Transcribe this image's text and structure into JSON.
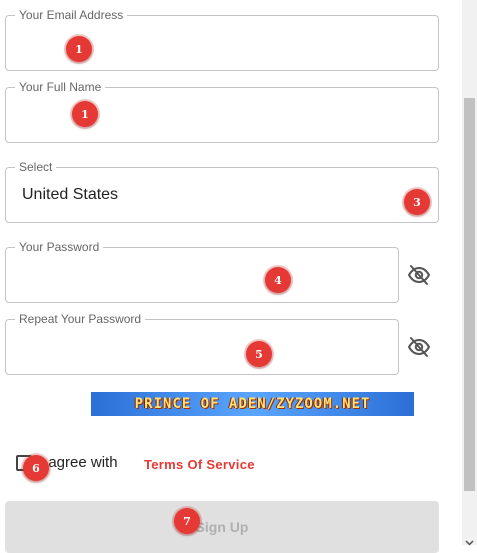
{
  "form": {
    "email": {
      "label": "Your Email Address",
      "value": ""
    },
    "full_name": {
      "label": "Your Full Name",
      "value": ""
    },
    "country": {
      "label": "Select",
      "value": "United States"
    },
    "password": {
      "label": "Your Password",
      "value": ""
    },
    "repeat_password": {
      "label": "Repeat Your Password",
      "value": ""
    },
    "agree_text": "I agree with",
    "terms_link": "Terms Of Service",
    "submit_label": "Sign Up"
  },
  "banner": {
    "text": "PRINCE OF ADEN/ZYZOOM.NET"
  },
  "annotations": [
    "1",
    "1",
    "3",
    "4",
    "5",
    "6",
    "7"
  ],
  "icons": {
    "password_toggle": "eye-slash-icon",
    "repeat_password_toggle": "eye-slash-icon",
    "scroll_down": "chevron-down-icon"
  },
  "colors": {
    "accent": "#e53935",
    "button_bg": "#e0e0e0",
    "border": "#c4c4c4"
  }
}
